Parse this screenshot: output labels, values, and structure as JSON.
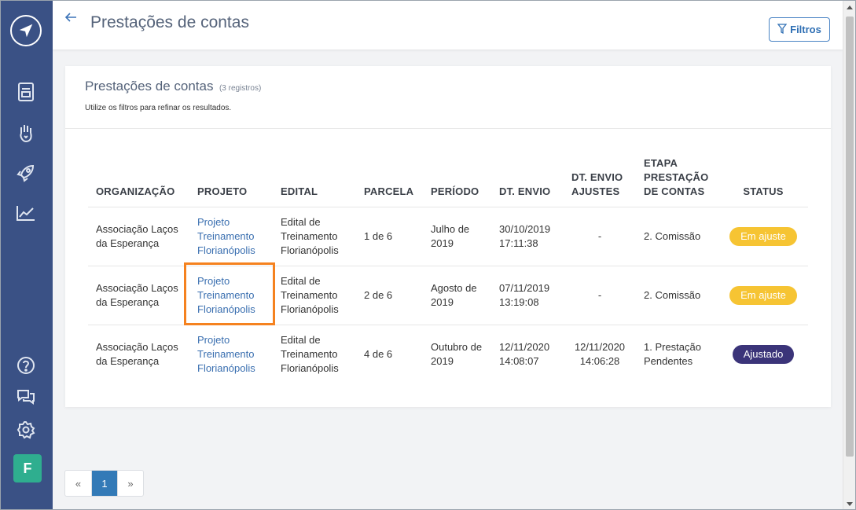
{
  "header": {
    "back_icon": "arrow-left-icon",
    "title": "Prestações de contas",
    "filter_label": "Filtros"
  },
  "sidebar": {
    "icons": [
      "compass-logo",
      "document-icon",
      "hand-heart-icon",
      "rocket-icon",
      "chart-icon",
      "help-icon",
      "chat-icon",
      "gear-icon"
    ],
    "avatar_letter": "F"
  },
  "card": {
    "title": "Prestações de contas",
    "count": "(3 registros)",
    "subtitle": "Utilize os filtros para refinar os resultados."
  },
  "table": {
    "headers": {
      "organizacao": "ORGANIZAÇÃO",
      "projeto": "PROJETO",
      "edital": "EDITAL",
      "parcela": "PARCELA",
      "periodo": "PERÍODO",
      "dt_envio": "DT. ENVIO",
      "dt_envio_ajustes": "DT. ENVIO AJUSTES",
      "etapa": "ETAPA PRESTAÇÃO DE CONTAS",
      "status": "STATUS"
    },
    "rows": [
      {
        "organizacao": "Associação Laços da Esperança",
        "projeto": "Projeto Treinamento Florianópolis",
        "edital": "Edital de Treinamento Florianópolis",
        "parcela": "1 de 6",
        "periodo": "Julho de 2019",
        "dt_envio": "30/10/2019 17:11:38",
        "dt_envio_ajustes": "-",
        "etapa": "2. Comissão",
        "status": "Em ajuste"
      },
      {
        "organizacao": "Associação Laços da Esperança",
        "projeto": "Projeto Treinamento Florianópolis",
        "edital": "Edital de Treinamento Florianópolis",
        "parcela": "2 de 6",
        "periodo": "Agosto de 2019",
        "dt_envio": "07/11/2019 13:19:08",
        "dt_envio_ajustes": "-",
        "etapa": "2. Comissão",
        "status": "Em ajuste"
      },
      {
        "organizacao": "Associação Laços da Esperança",
        "projeto": "Projeto Treinamento Florianópolis",
        "edital": "Edital de Treinamento Florianópolis",
        "parcela": "4 de 6",
        "periodo": "Outubro de 2019",
        "dt_envio": "12/11/2020 14:08:07",
        "dt_envio_ajustes": "12/11/2020 14:06:28",
        "etapa": "1. Prestação Pendentes",
        "status": "Ajustado"
      }
    ]
  },
  "pagination": {
    "prev": "«",
    "current": "1",
    "next": "»"
  },
  "colors": {
    "sidebar": "#3a5185",
    "accent": "#337ab7",
    "badge_em_ajuste": "#f6c433",
    "badge_ajustado": "#3b3479",
    "highlight": "#f5821f"
  }
}
